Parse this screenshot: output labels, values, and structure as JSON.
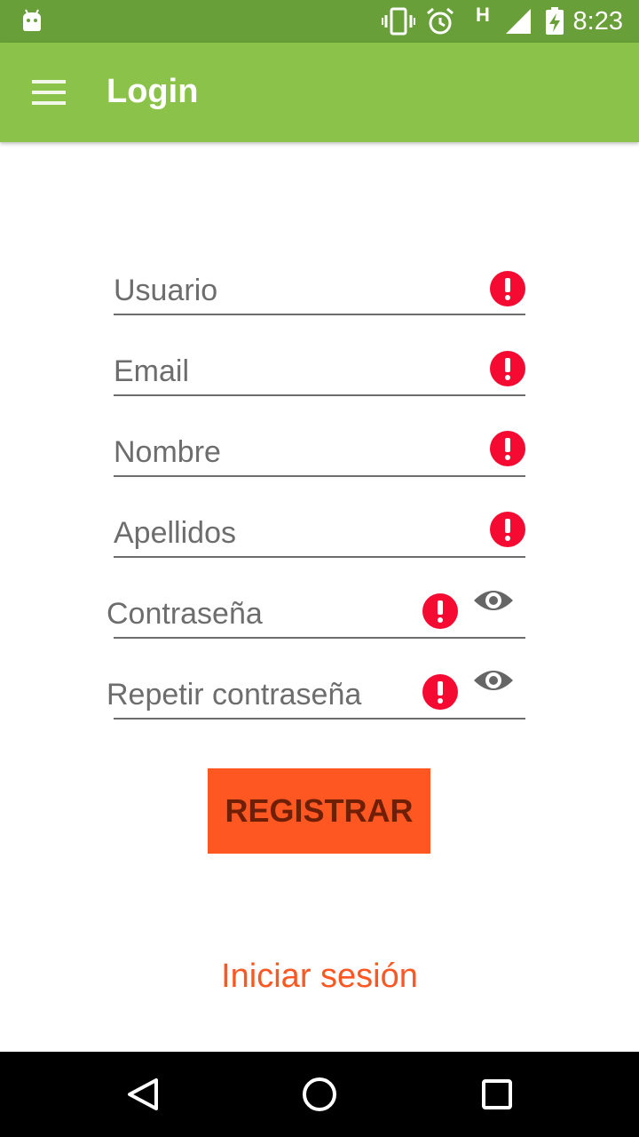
{
  "status_bar": {
    "time": "8:23",
    "network_label": "H",
    "icons": [
      "android-icon",
      "vibrate-icon",
      "alarm-icon",
      "signal-icon",
      "battery-charging-icon"
    ]
  },
  "app_bar": {
    "title": "Login",
    "menu_icon": "hamburger-menu-icon"
  },
  "form": {
    "fields": [
      {
        "placeholder": "Usuario",
        "value": "",
        "error_icon": "error-icon"
      },
      {
        "placeholder": "Email",
        "value": "",
        "error_icon": "error-icon"
      },
      {
        "placeholder": "Nombre",
        "value": "",
        "error_icon": "error-icon"
      },
      {
        "placeholder": "Apellidos",
        "value": "",
        "error_icon": "error-icon"
      },
      {
        "placeholder": "Contraseña",
        "value": "",
        "error_icon": "error-icon",
        "toggle_icon": "eye-icon"
      },
      {
        "placeholder": "Repetir contraseña",
        "value": "",
        "error_icon": "error-icon",
        "toggle_icon": "eye-icon"
      }
    ],
    "register_label": "REGISTRAR",
    "login_link": "Iniciar sesión"
  },
  "nav_bar": {
    "icons": [
      "back-icon",
      "home-icon",
      "recents-icon"
    ]
  },
  "colors": {
    "status_bar": "#689f38",
    "app_bar": "#8bc34a",
    "accent": "#ff5722",
    "error": "#f50b32",
    "nav_bar": "#000000"
  }
}
